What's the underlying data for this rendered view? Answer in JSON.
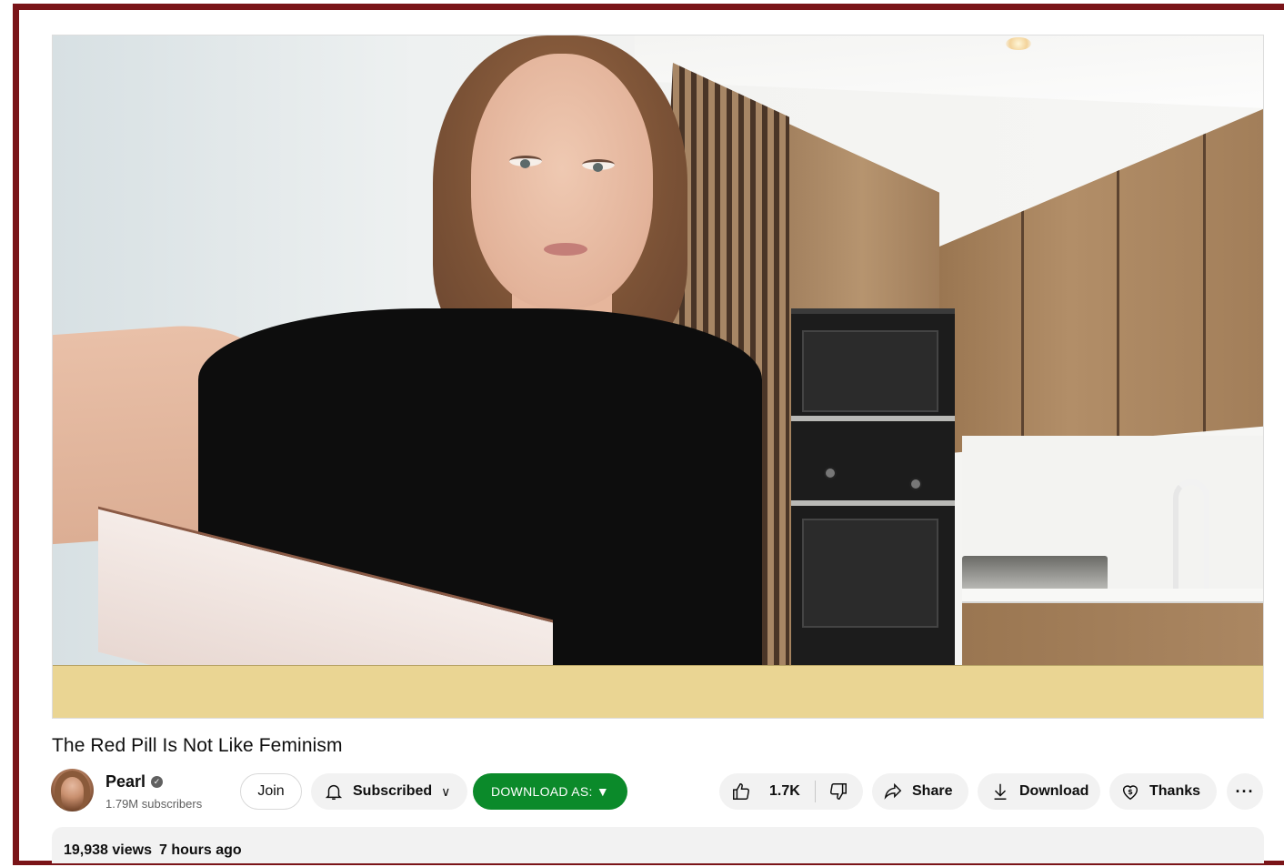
{
  "video": {
    "title": "The Red Pill Is Not Like Feminism",
    "letterbox_color": "#ead593"
  },
  "channel": {
    "name": "Pearl",
    "verified_icon": "verified-check-icon",
    "subscribers": "1.79M subscribers",
    "avatar_icon": "channel-avatar"
  },
  "actions": {
    "join_label": "Join",
    "subscribed_label": "Subscribed",
    "subscribed_chevron": "∨",
    "download_as_label": "DOWNLOAD AS: ▼",
    "download_as_color": "#0b8a2a",
    "like_count": "1.7K",
    "share_label": "Share",
    "download_label": "Download",
    "thanks_label": "Thanks",
    "more_label": "···"
  },
  "description": {
    "views": "19,938 views",
    "uploaded": "7 hours ago"
  },
  "colors": {
    "frame": "#7a1418",
    "pill_bg": "#f2f2f2"
  }
}
